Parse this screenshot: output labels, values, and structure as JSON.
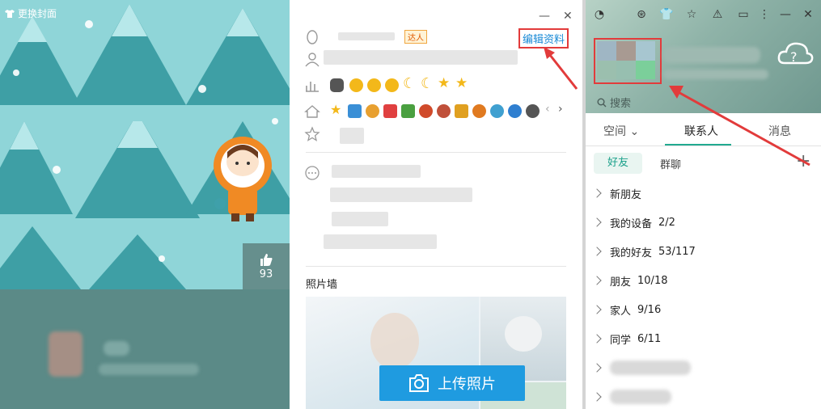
{
  "left_panel": {
    "change_skin": "更换封面",
    "like_count": "93"
  },
  "profile": {
    "edit_label": "编辑资料",
    "vip_badge": "达人",
    "photo_wall_label": "照片墙",
    "upload_label": "上传照片"
  },
  "qq": {
    "search_placeholder": "搜索",
    "tabs": [
      {
        "label": "空间"
      },
      {
        "label": "联系人"
      },
      {
        "label": "消息"
      }
    ],
    "subtabs": {
      "friends": "好友",
      "groups": "群聊"
    },
    "groups": [
      {
        "label": "新朋友",
        "count": ""
      },
      {
        "label": "我的设备",
        "count": "2/2"
      },
      {
        "label": "我的好友",
        "count": "53/117"
      },
      {
        "label": "朋友",
        "count": "10/18"
      },
      {
        "label": "家人",
        "count": "9/16"
      },
      {
        "label": "同学",
        "count": "6/11"
      }
    ]
  },
  "colors": {
    "accent_teal": "#22aa90",
    "link_blue": "#1a8ad6",
    "highlight_red": "#e23b3b",
    "upload_blue": "#1f9be0"
  }
}
